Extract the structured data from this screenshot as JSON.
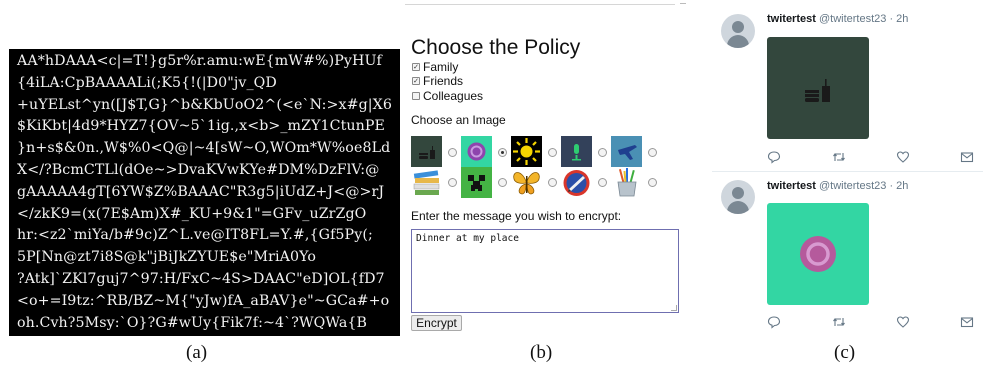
{
  "panel_a": {
    "cipher_lines": [
      "AA*hDAAA<c|=T!}g5r%r.amu:wE{mW#%)PyHUf",
      "{4iLA:CpBAAAALi(;K5{!(|D0\"jv_QD",
      "+uYELst^yn([J$T,G}^b&KbUoO2^(<e`N:>x#g|X6",
      "$KiKbt|4d9*HYZ7{OV~5`1ig.,x<b>_mZY1CtunPE",
      "}n+s$&0n.,W$%0<Q@|~4[sW~O,WOm*W%oe8Ld",
      "X</?BcmCTLl(dOe~>DvaKVwKYe#DM%DzFlV:@",
      "gAAAAA4gT[6YW$Z%BAAAC\"R3g5|iUdZ+J<@>rJ",
      "</zkK9=(x(7E$Am)X#_KU+9&1\"=GFv_uZrZgO",
      "hr:<z2`miYa/b#9c)Z^L.ve@IT8FL=Y.#,{Gf5Py(;",
      "5P[Nn@zt7i8S@k\"jBiJkZYUE$e\"MriA0Yo",
      "?Atk]`ZKl7guj7^97:H/FxC~4S>DAAC\"eD]OL{fD7",
      "<o+=I9tz:^RB/BZ~M{\"yJw)fA_aBAV}e\"~GCa#+o",
      "oh.Cvh?5Msy:`O}?G#wUy{Fik7f:~4`?WQWa{B"
    ],
    "caption": "(a)"
  },
  "panel_b": {
    "title": "Choose the Policy",
    "policies": [
      {
        "label": "Family",
        "checked": true
      },
      {
        "label": "Friends",
        "checked": true
      },
      {
        "label": "Colleagues",
        "checked": false
      }
    ],
    "choose_image_label": "Choose an Image",
    "image_options": [
      {
        "icon": "food-drink-icon",
        "selected": false
      },
      {
        "icon": "ubuntu-circle-icon",
        "selected": true
      },
      {
        "icon": "sun-icon",
        "selected": false
      },
      {
        "icon": "microphone-icon",
        "selected": false
      },
      {
        "icon": "airplane-icon",
        "selected": false
      },
      {
        "icon": "books-icon",
        "selected": false
      },
      {
        "icon": "creeper-icon",
        "selected": false
      },
      {
        "icon": "butterfly-icon",
        "selected": false
      },
      {
        "icon": "pen-badge-icon",
        "selected": false
      },
      {
        "icon": "pencil-cup-icon",
        "selected": false
      }
    ],
    "message_label": "Enter the message you wish to encrypt:",
    "message_value": "Dinner at my place",
    "encrypt_label": "Encrypt",
    "caption": "(b)"
  },
  "panel_c": {
    "tweets": [
      {
        "name": "twitertest",
        "handle": "@twitertest23",
        "time": "· 2h",
        "image_icon": "food-drink-icon",
        "image_bg": "#33473d"
      },
      {
        "name": "twitertest",
        "handle": "@twitertest23",
        "time": "· 2h",
        "image_icon": "ubuntu-circle-icon",
        "image_bg": "#33d6a3"
      }
    ],
    "actions": [
      "reply-icon",
      "retweet-icon",
      "like-icon",
      "message-icon"
    ],
    "caption": "(c)"
  },
  "colors": {
    "cipher_bg": "#000000",
    "textarea_border": "#6f6fb0",
    "twitter_gray": "#657786"
  }
}
